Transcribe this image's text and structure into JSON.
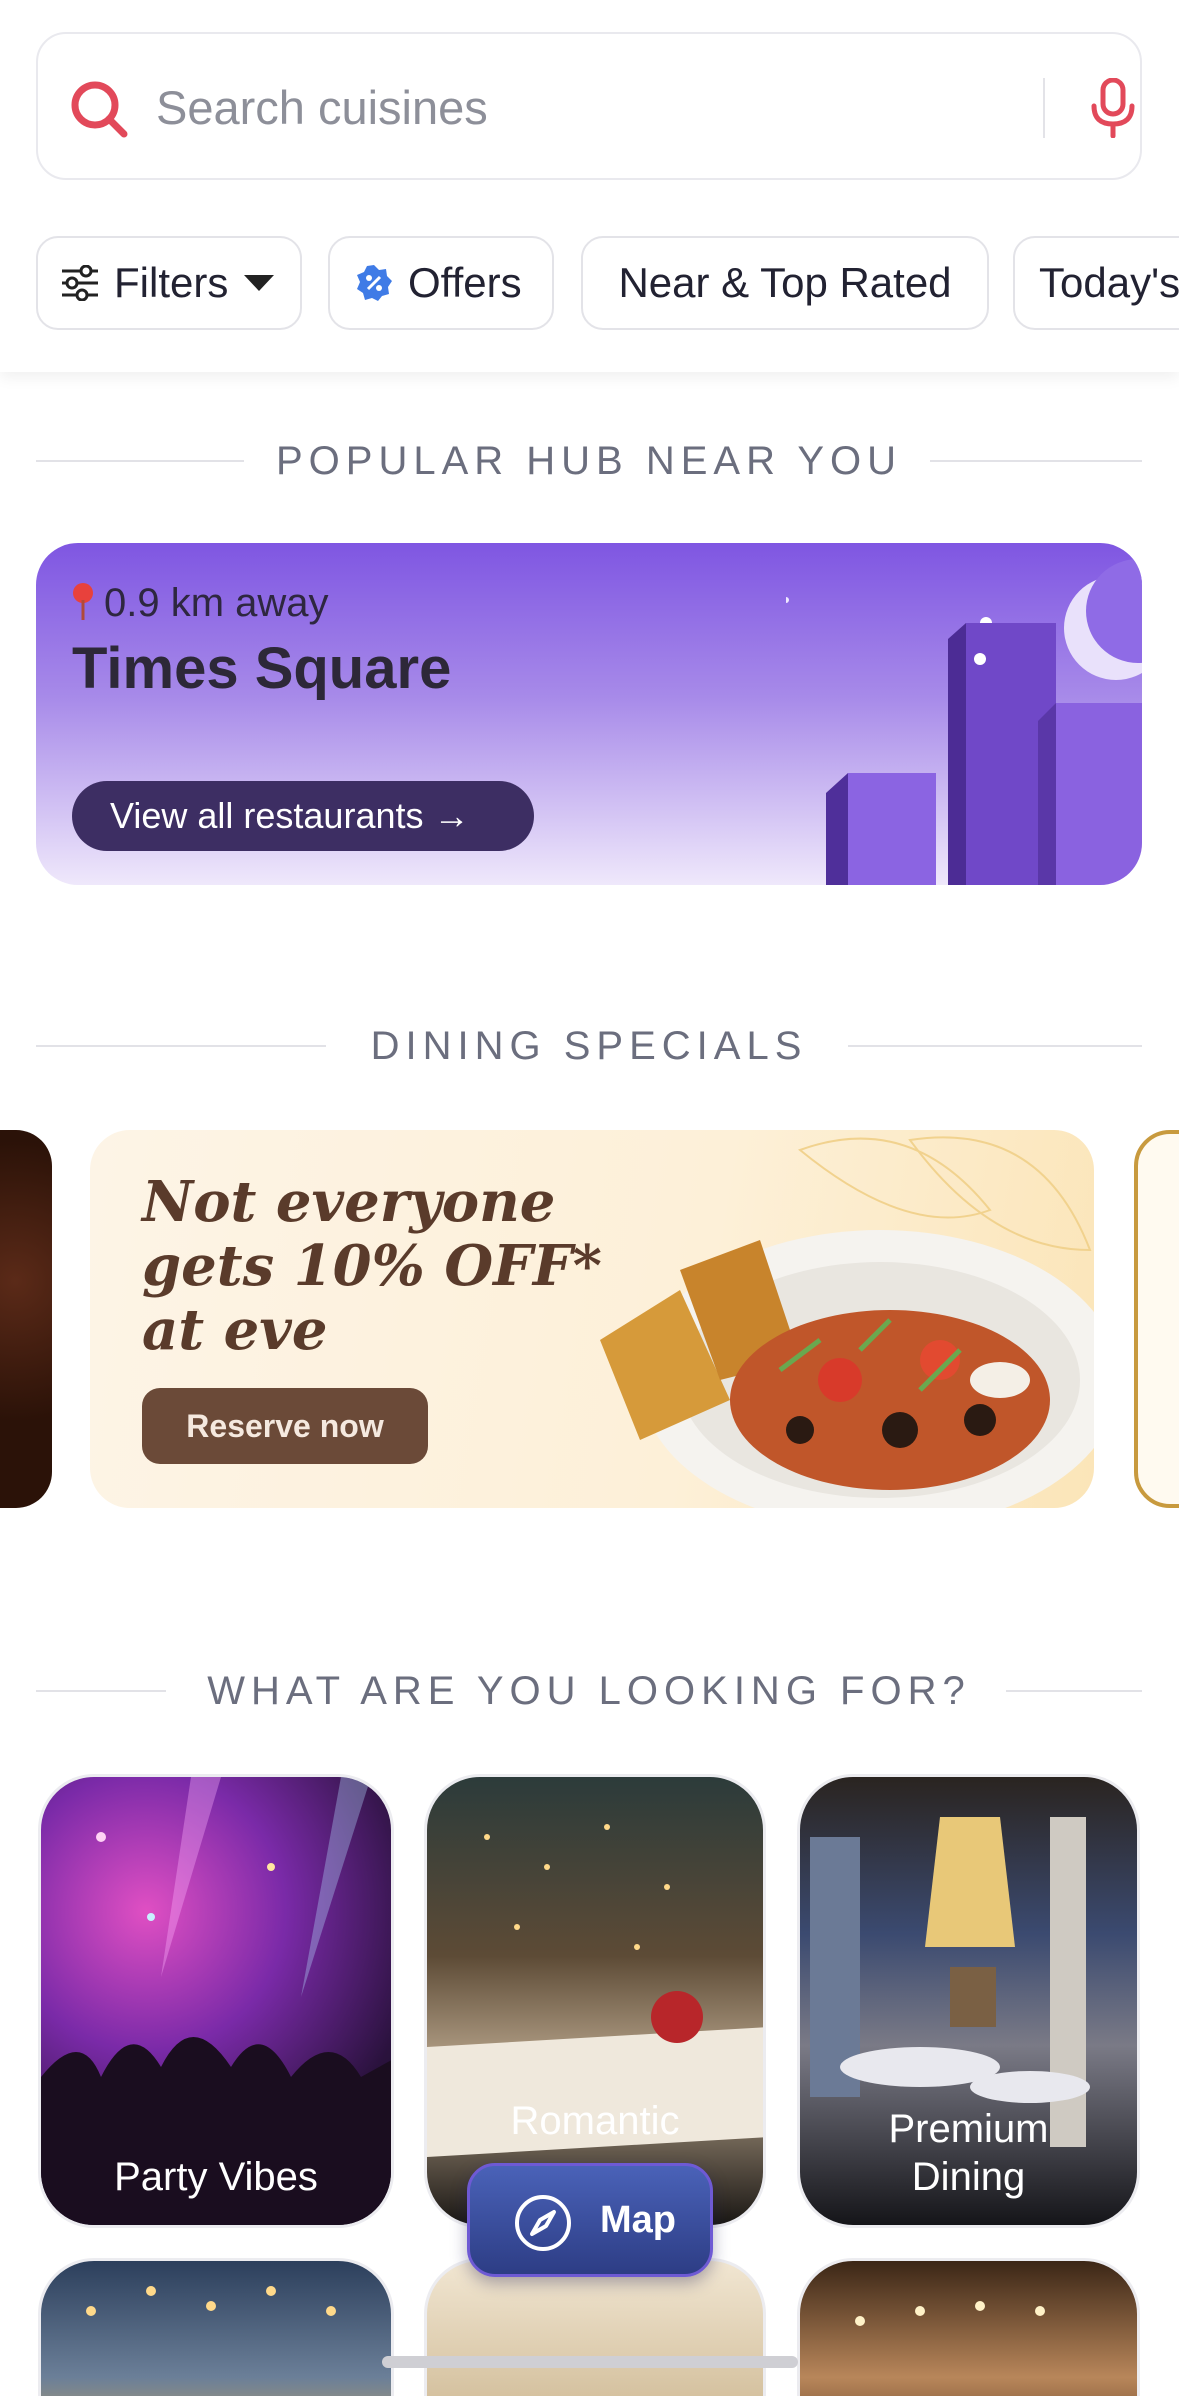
{
  "search": {
    "placeholder": "Search cuisines"
  },
  "chips": {
    "filters": "Filters",
    "offers": "Offers",
    "near_top_rated": "Near & Top Rated",
    "today": "Today's"
  },
  "sections": {
    "popular_hub": "POPULAR HUB NEAR YOU",
    "dining_specials": "DINING SPECIALS",
    "looking_for": "WHAT ARE YOU LOOKING FOR?"
  },
  "hub": {
    "distance": "0.9 km away",
    "title": "Times Square",
    "button": "View all restaurants →"
  },
  "special": {
    "headline_1": "Not everyone",
    "headline_2": "gets 10% OFF*",
    "headline_3": "at eve",
    "button": "Reserve now"
  },
  "categories": [
    {
      "label": "Party Vibes"
    },
    {
      "label": "Romantic"
    },
    {
      "label_1": "Premium",
      "label_2": "Dining"
    }
  ],
  "map": {
    "label": "Map"
  },
  "colors": {
    "accent_red": "#e2495a",
    "hub_purple": "#7f56e2",
    "map_blue": "#3b4fa0"
  }
}
